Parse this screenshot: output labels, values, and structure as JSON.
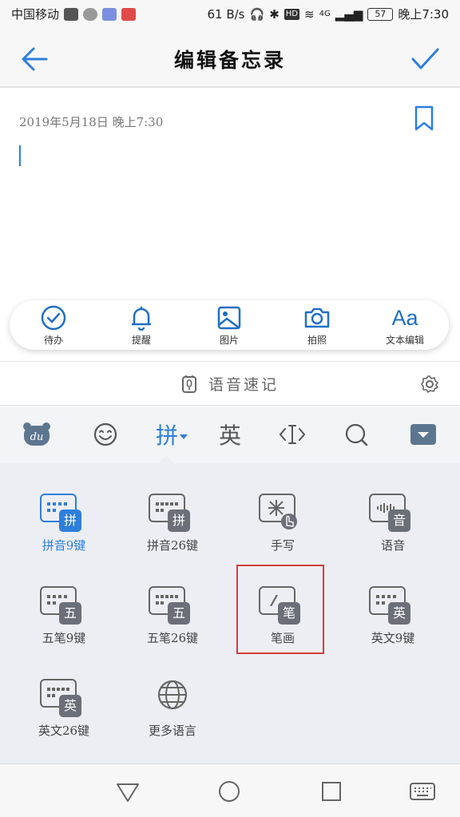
{
  "status": {
    "carrier": "中国移动",
    "speed": "61 B/s",
    "net": "4G",
    "battery": "57",
    "time": "晚上7:30"
  },
  "header": {
    "title": "编辑备忘录"
  },
  "note": {
    "date": "2019年5月18日 晚上7:30"
  },
  "toolbar": {
    "items": [
      {
        "label": "待办",
        "icon": "todo-check-icon"
      },
      {
        "label": "提醒",
        "icon": "bell-icon"
      },
      {
        "label": "图片",
        "icon": "image-icon"
      },
      {
        "label": "拍照",
        "icon": "camera-icon"
      },
      {
        "label": "文本编辑",
        "glyph": "Aa",
        "icon": "text-format-icon"
      }
    ]
  },
  "voice": {
    "label": "语音速记"
  },
  "keyboard": {
    "tabs": {
      "pinyin": "拼",
      "english": "英"
    },
    "layouts": [
      {
        "name": "拼音9键",
        "badge": "拼",
        "active": true
      },
      {
        "name": "拼音26键",
        "badge": "拼"
      },
      {
        "name": "手写",
        "badge": ""
      },
      {
        "name": "语音",
        "badge": "音"
      },
      {
        "name": "五笔9键",
        "badge": "五"
      },
      {
        "name": "五笔26键",
        "badge": "五"
      },
      {
        "name": "笔画",
        "badge": "笔"
      },
      {
        "name": "英文9键",
        "badge": "英"
      },
      {
        "name": "英文26键",
        "badge": "英"
      },
      {
        "name": "更多语言",
        "badge": ""
      }
    ]
  },
  "colors": {
    "accent": "#2d7fdb",
    "highlight": "#d43c3c"
  }
}
